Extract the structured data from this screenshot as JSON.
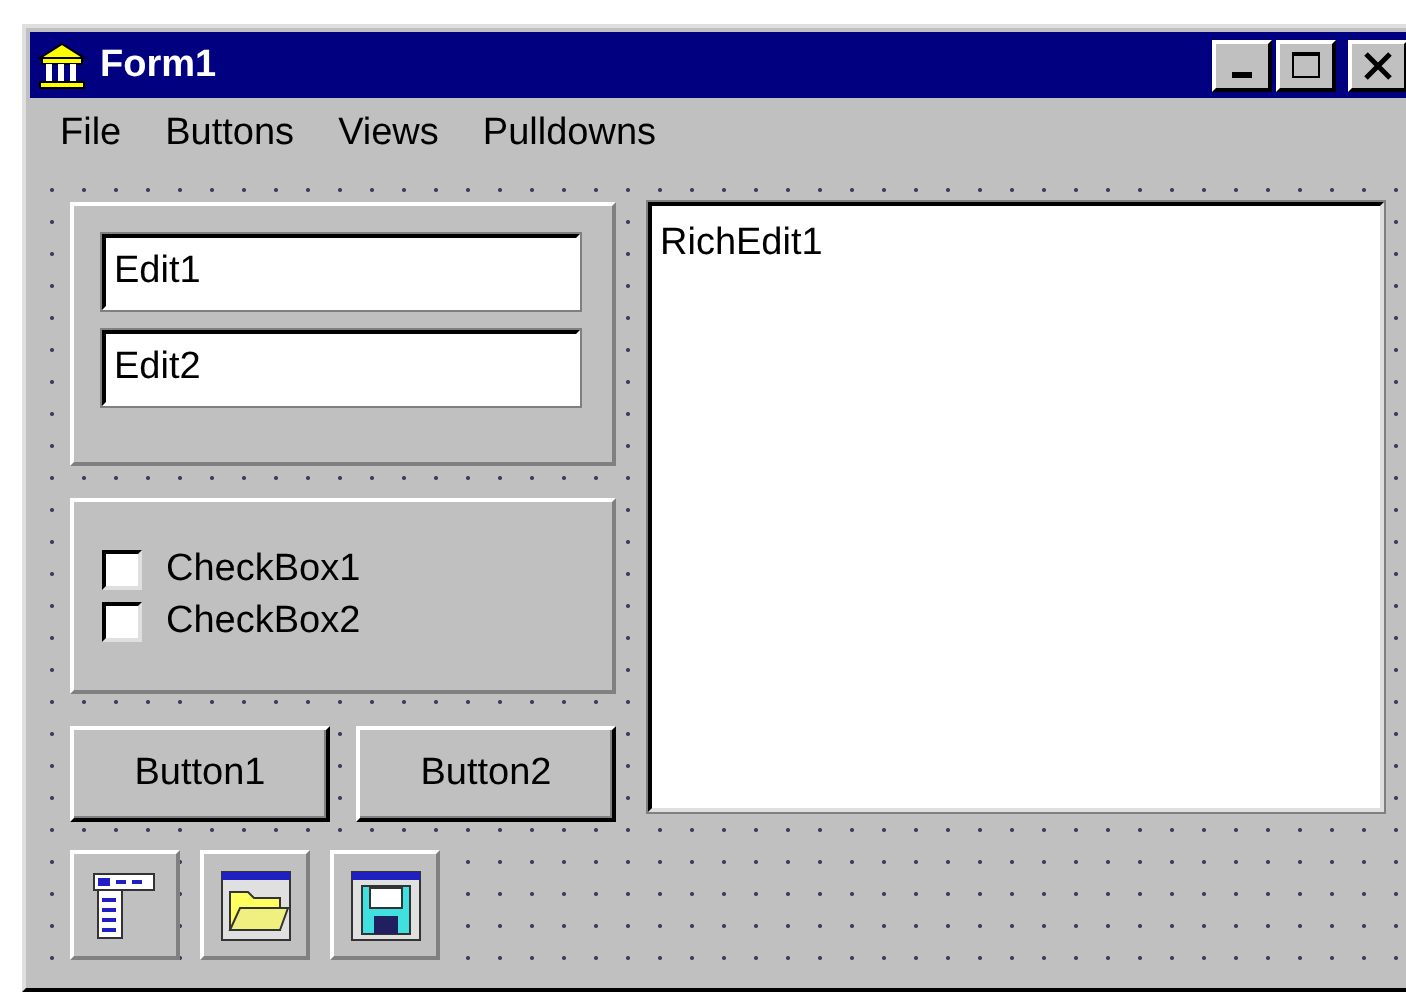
{
  "window": {
    "title": "Form1"
  },
  "menu": [
    "File",
    "Buttons",
    "Views",
    "Pulldowns"
  ],
  "edits": [
    {
      "value": "Edit1"
    },
    {
      "value": "Edit2"
    }
  ],
  "checkboxes": [
    {
      "label": "CheckBox1",
      "checked": false
    },
    {
      "label": "CheckBox2",
      "checked": false
    }
  ],
  "buttons": [
    "Button1",
    "Button2"
  ],
  "rich_edit": {
    "value": "RichEdit1"
  }
}
